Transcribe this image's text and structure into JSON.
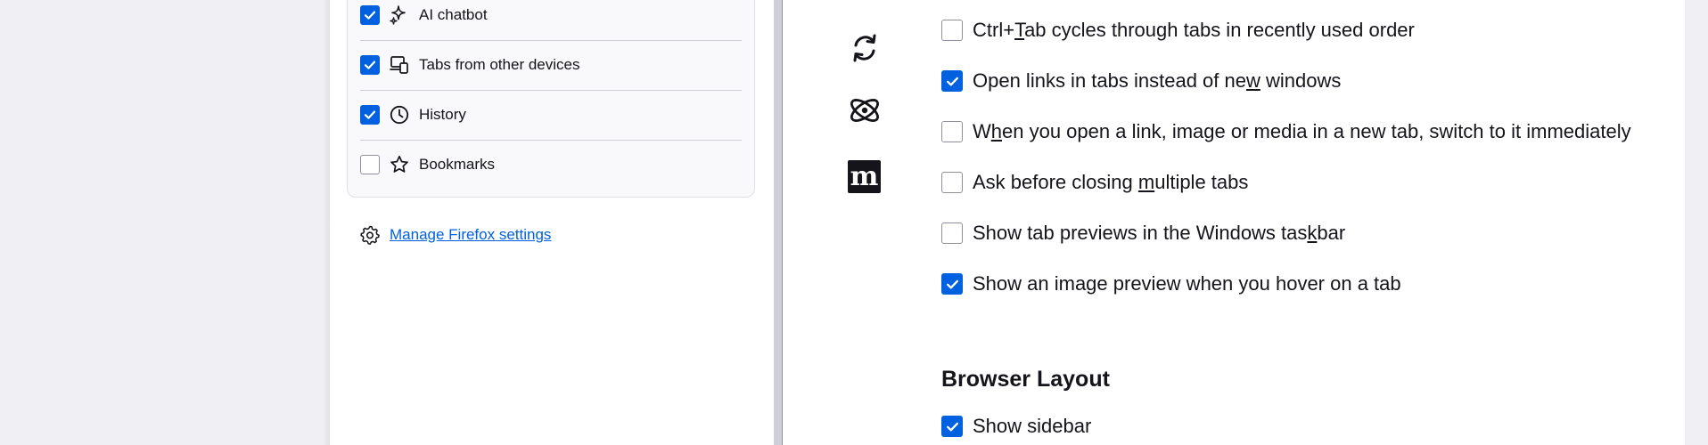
{
  "sidebar_options": {
    "items": [
      {
        "label": "AI chatbot",
        "checked": true,
        "icon": "sparkle-icon"
      },
      {
        "label": "Tabs from other devices",
        "checked": true,
        "icon": "synced-tabs-icon"
      },
      {
        "label": "History",
        "checked": true,
        "icon": "clock-icon"
      },
      {
        "label": "Bookmarks",
        "checked": false,
        "icon": "star-icon"
      }
    ],
    "manage_link": "Manage Firefox settings"
  },
  "addon_icons": [
    "sync-arrows-icon",
    "atom-icon",
    "m-logo-icon"
  ],
  "m_logo_letter": "m",
  "tab_settings": [
    {
      "checked": false,
      "pre": "Ctrl+",
      "key": "T",
      "post": "ab cycles through tabs in recently used order"
    },
    {
      "checked": true,
      "pre": "Open links in tabs instead of ne",
      "key": "w",
      "post": " windows"
    },
    {
      "checked": false,
      "pre": "W",
      "key": "h",
      "post": "en you open a link, image or media in a new tab, switch to it immediately"
    },
    {
      "checked": false,
      "pre": "Ask before closing ",
      "key": "m",
      "post": "ultiple tabs"
    },
    {
      "checked": false,
      "pre": "Show tab previews in the Windows tas",
      "key": "k",
      "post": "bar"
    },
    {
      "checked": true,
      "pre": "Show an image preview when you hover on a tab",
      "key": "",
      "post": ""
    }
  ],
  "browser_layout": {
    "heading": "Browser Layout",
    "show_sidebar": {
      "label": "Show sidebar",
      "checked": true
    }
  },
  "colors": {
    "accent": "#0061e0",
    "text": "#15141a",
    "background": "#f0f0f4"
  }
}
